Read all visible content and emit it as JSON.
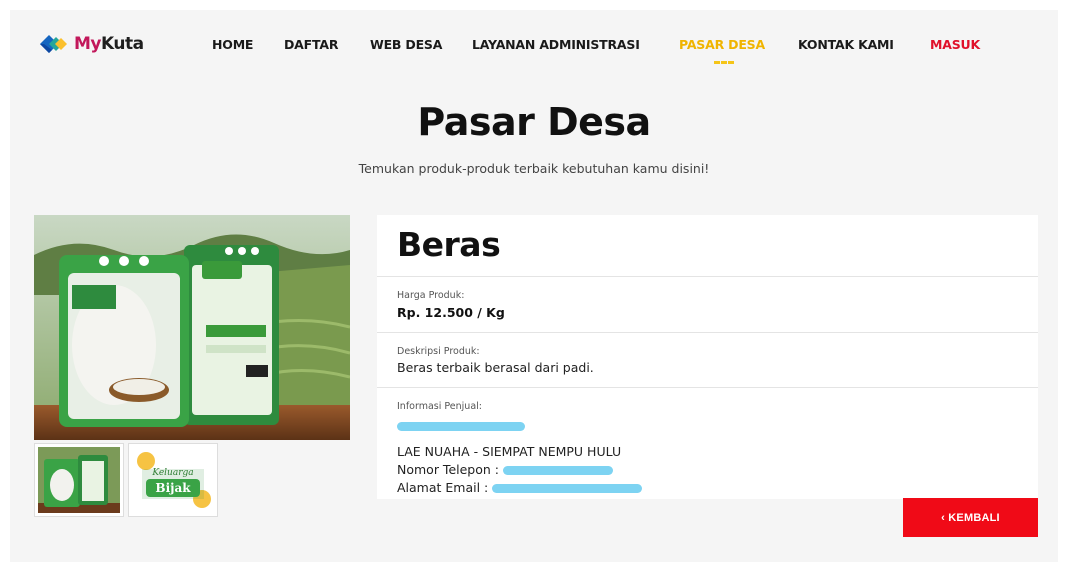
{
  "header": {
    "logo": {
      "my": "My",
      "kuta": "Kuta"
    },
    "nav": [
      {
        "label": "HOME"
      },
      {
        "label": "DAFTAR"
      },
      {
        "label": "WEB DESA"
      },
      {
        "label": "LAYANAN ADMINISTRASI"
      },
      {
        "label": "PASAR DESA",
        "active": true
      },
      {
        "label": "KONTAK KAMI"
      },
      {
        "label": "MASUK"
      }
    ]
  },
  "hero": {
    "title": "Pasar Desa",
    "subtitle": "Temukan produk-produk terbaik kebutuhan kamu disini!"
  },
  "product": {
    "name": "Beras",
    "price_label": "Harga Produk:",
    "price": "Rp. 12.500 / Kg",
    "description_label": "Deskripsi Produk:",
    "description": "Beras terbaik berasal dari padi.",
    "seller_label": "Informasi Penjual:",
    "seller_location": "LAE NUAHA - SIEMPAT NEMPU HULU",
    "phone_label": "Nomor Telepon :",
    "email_label": "Alamat Email :",
    "image_brand_line1": "Keluarga",
    "image_brand_line2": "Bijak"
  },
  "actions": {
    "back_label": "‹ KEMBALI"
  },
  "colors": {
    "accent": "#f0b400",
    "login": "#e0102a",
    "button": "#f00a17",
    "redaction": "#7dd3f2",
    "background": "#f5f5f5"
  }
}
